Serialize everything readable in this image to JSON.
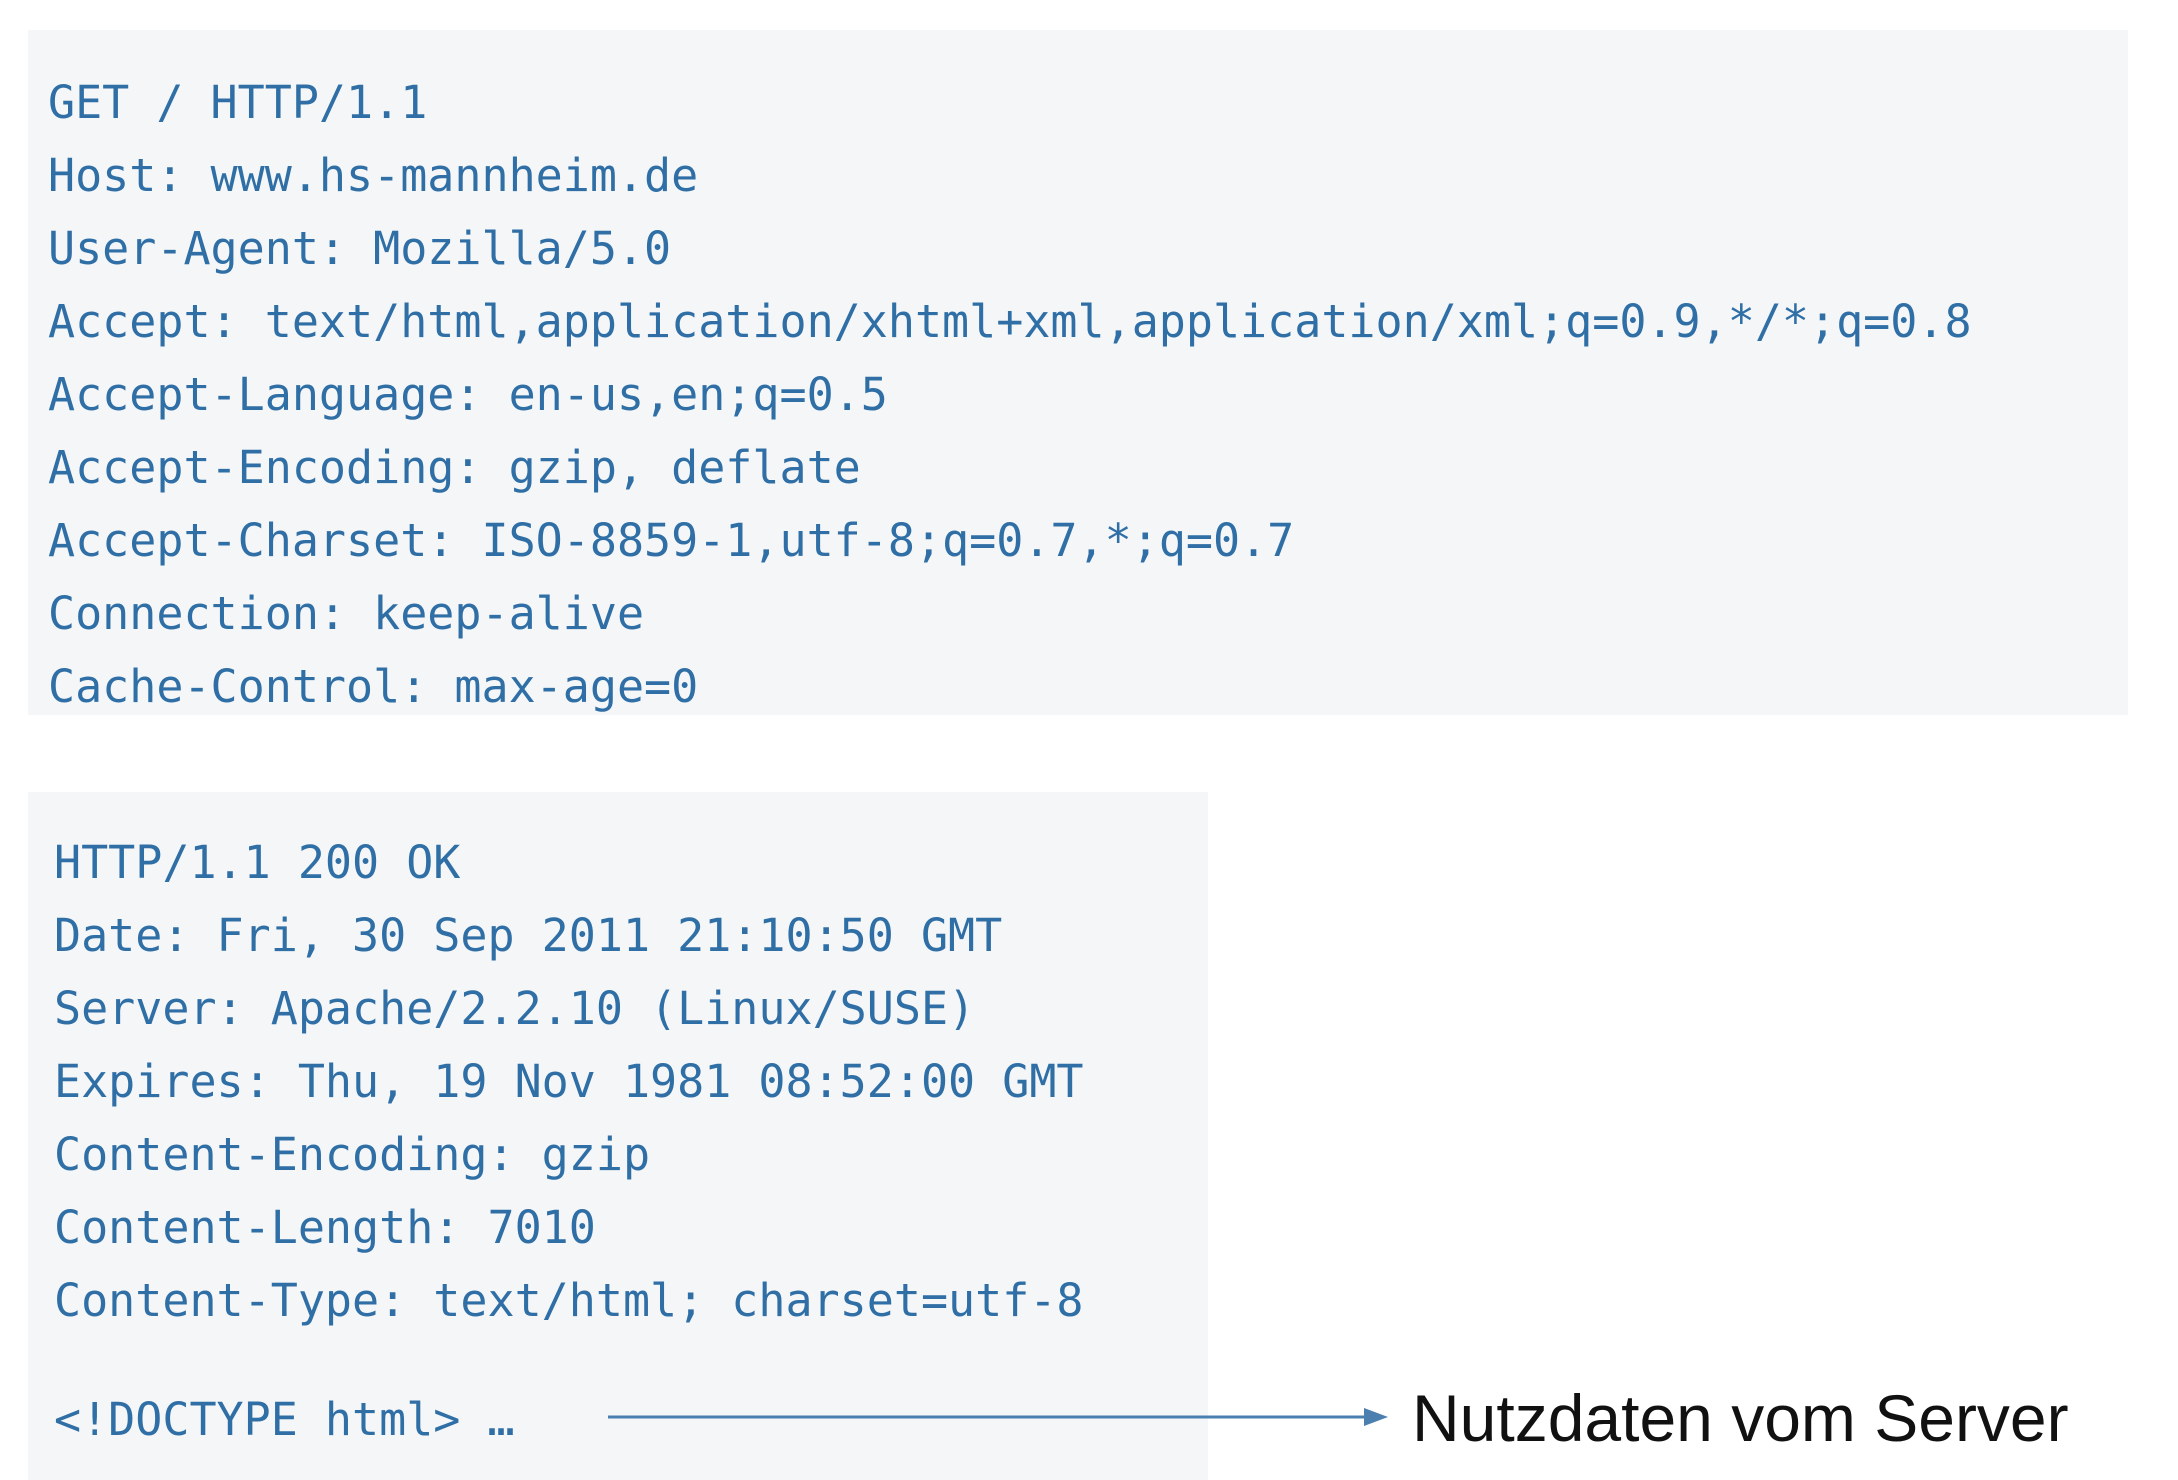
{
  "request": {
    "lines": [
      "GET / HTTP/1.1",
      "Host: www.hs-mannheim.de",
      "User-Agent: Mozilla/5.0",
      "Accept: text/html,application/xhtml+xml,application/xml;q=0.9,*/*;q=0.8",
      "Accept-Language: en-us,en;q=0.5",
      "Accept-Encoding: gzip, deflate",
      "Accept-Charset: ISO-8859-1,utf-8;q=0.7,*;q=0.7",
      "Connection: keep-alive",
      "Cache-Control: max-age=0"
    ]
  },
  "response": {
    "lines": [
      "HTTP/1.1 200 OK",
      "Date: Fri, 30 Sep 2011 21:10:50 GMT",
      "Server: Apache/2.2.10 (Linux/SUSE)",
      "Expires: Thu, 19 Nov 1981 08:52:00 GMT",
      "Content-Encoding: gzip",
      "Content-Length: 7010",
      "Content-Type: text/html; charset=utf-8"
    ],
    "body_preview": "<!DOCTYPE html> …"
  },
  "annotation": {
    "label": "Nutzdaten vom Server",
    "arrow_color": "#4a7fb0"
  },
  "colors": {
    "code_text": "#2f6fa6",
    "box_background": "#f4f6f8",
    "label_text": "#111111"
  }
}
